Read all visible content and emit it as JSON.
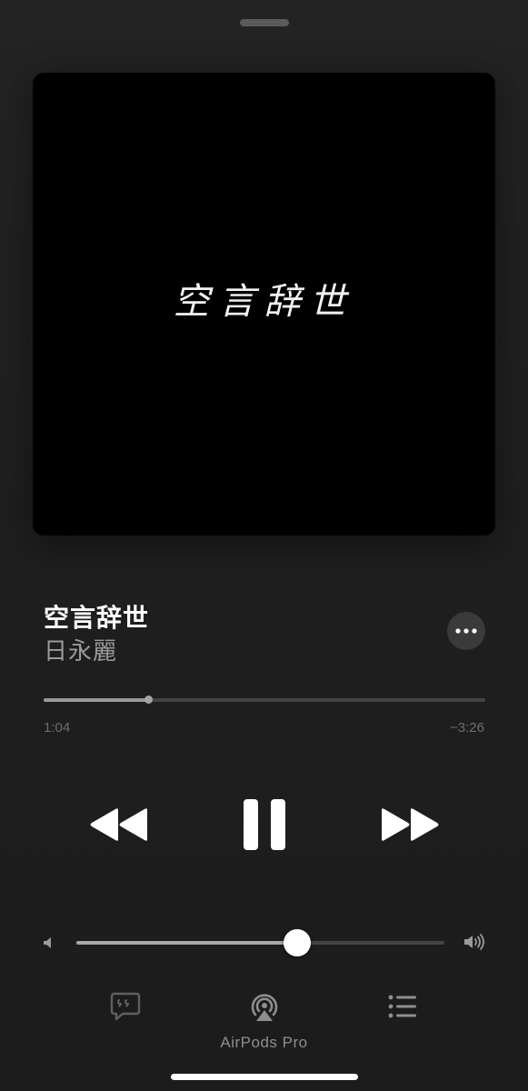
{
  "artwork": {
    "text": "空言辞世"
  },
  "song": {
    "title": "空言辞世",
    "artist": "日永麗"
  },
  "progress": {
    "elapsed": "1:04",
    "remaining": "−3:26",
    "fraction": 0.236
  },
  "volume": {
    "fraction": 0.6
  },
  "controls": {
    "rewind_icon": "backward-icon",
    "pause_icon": "pause-icon",
    "forward_icon": "forward-icon",
    "more_icon": "ellipsis-icon"
  },
  "bottom_bar": {
    "lyrics_icon": "lyrics-icon",
    "airplay_icon": "airplay-icon",
    "airplay_label": "AirPods Pro",
    "queue_icon": "queue-icon"
  },
  "colors": {
    "background": "#1e1e1e",
    "primary_text": "#ffffff",
    "secondary_text": "#9b9b9b",
    "muted": "#6f6f6f"
  }
}
